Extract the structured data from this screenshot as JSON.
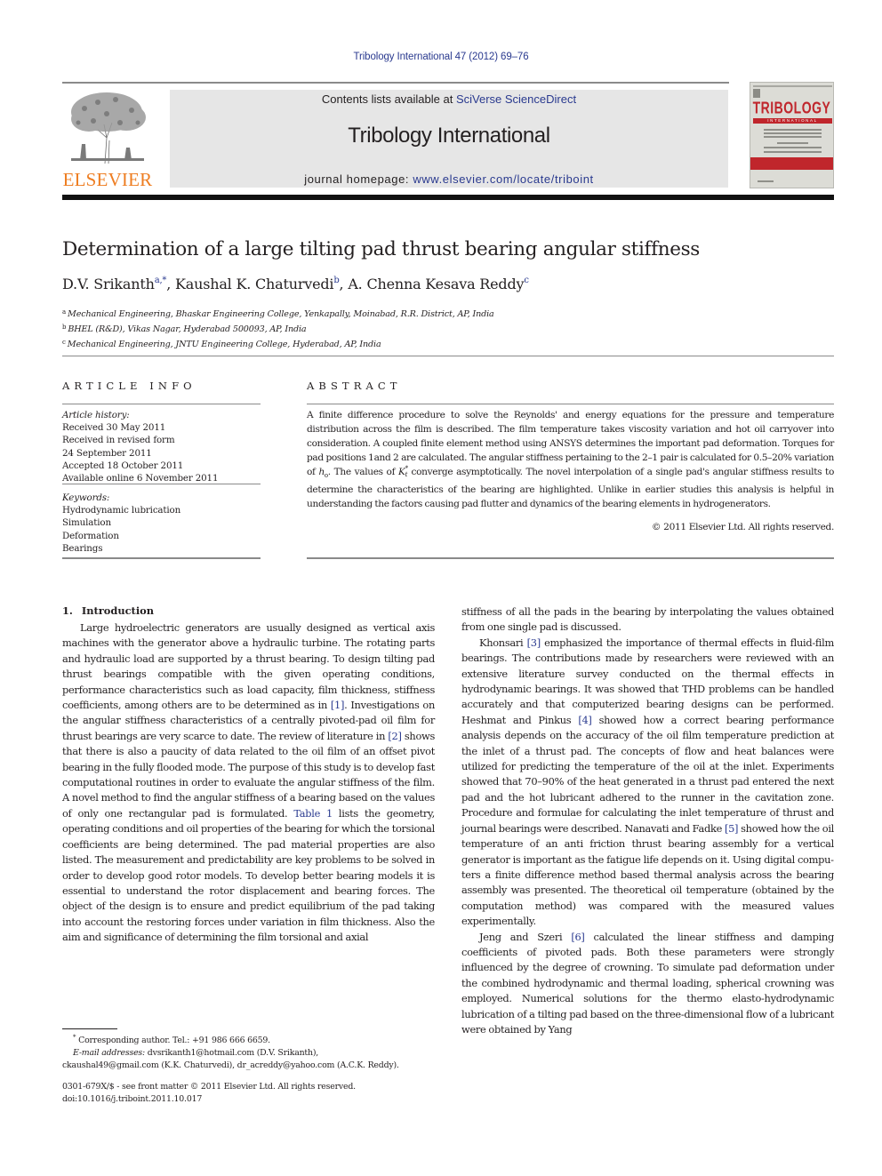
{
  "header": {
    "citation": "Tribology International 47 (2012) 69–76",
    "contents_prefix": "Contents lists available at ",
    "contents_link": "SciVerse ScienceDirect",
    "journal_title": "Tribology International",
    "homepage_prefix": "journal homepage: ",
    "homepage_link": "www.elsevier.com/locate/triboint",
    "publisher_logo_text": "ELSEVIER",
    "cover": {
      "title": "TRIBOLOGY",
      "subtitle": "INTERNATIONAL"
    },
    "colors": {
      "link": "#2a3a8f",
      "elsevier_orange": "#ee7d21",
      "cover_red": "#c0262c",
      "masthead_bg": "#e6e6e6"
    }
  },
  "article": {
    "title": "Determination of a large tilting pad thrust bearing angular stiffness",
    "authors": [
      {
        "name": "D.V. Srikanth",
        "sup": "a,*",
        "sep": ", "
      },
      {
        "name": "Kaushal K. Chaturvedi",
        "sup": "b",
        "sep": ", "
      },
      {
        "name": "A. Chenna Kesava Reddy",
        "sup": "c",
        "sep": ""
      }
    ],
    "affiliations": [
      {
        "key": "a",
        "text": "Mechanical Engineering, Bhaskar Engineering College, Yenkapally, Moinabad, R.R. District, AP, India"
      },
      {
        "key": "b",
        "text": "BHEL (R&D), Vikas Nagar, Hyderabad 500093, AP, India"
      },
      {
        "key": "c",
        "text": "Mechanical Engineering, JNTU Engineering College, Hyderabad, AP, India"
      }
    ]
  },
  "article_info": {
    "heading": "ARTICLE INFO",
    "history_label": "Article history:",
    "history": [
      "Received 30 May 2011",
      "Received in revised form",
      "24 September 2011",
      "Accepted 18 October 2011",
      "Available online 6 November 2011"
    ],
    "keywords_label": "Keywords:",
    "keywords": [
      "Hydrodynamic lubrication",
      "Simulation",
      "Deformation",
      "Bearings"
    ]
  },
  "abstract": {
    "heading": "ABSTRACT",
    "text_1": "A finite difference procedure to solve the Reynolds' and energy equations for the pressure and temperature distribution across the film is described. The film temperature takes viscosity variation and hot oil carryover into consideration. A coupled finite element method using ANSYS determines the important pad deformation. Torques for pad positions 1and 2 are calculated. The angular stiffness pertaining to the 2–1 pair is calculated for 0.5–20% variation of ",
    "sym_h": "h",
    "sym_h_sub": "o",
    "text_2": ". The values of ",
    "sym_k": "K",
    "sym_k_sup": "*",
    "sym_k_sub": "t",
    "text_3": " converge asymptotically. The novel interpolation of a single pad's angular stiffness results to determine the characteristics of the bearing are highlighted. Unlike in earlier studies this analysis is helpful in understanding the factors causing pad flutter and dynamics of the bearing elements in hydrogenerators.",
    "copyright": "© 2011 Elsevier Ltd. All rights reserved."
  },
  "body": {
    "section_number": "1.",
    "section_title": "Introduction",
    "left_p1_a": "Large hydroelectric generators are usually designed as vertical axis machines with the generator above a hydraulic turbine. The rotating parts and hydraulic load are supported by a thrust bearing. To design tilting pad thrust bearings compatible with the given operating conditions, performance characteristics such as load capa­city, film thickness, stiffness coefficients, among others are to be determined as in ",
    "ref1": "[1]",
    "left_p1_b": ". Investigations on the angular stiffness char­acteristics of a centrally pivoted-pad oil film for thrust bearings are very scarce to date. The review of literature in ",
    "ref2": "[2]",
    "left_p1_c": " shows that there is also a paucity of data related to the oil film of an offset pivot bearing in the fully flooded mode. The purpose of this study is to develop fast computational routines in order to evaluate the angular stiffness of the film. A novel method to find the angular stiffness of a bearing based on the values of only one rectangular pad is formulated. ",
    "table1": "Table 1",
    "left_p1_d": " lists the geometry, operating conditions and oil properties of the bearing for which the torsional coefficients are being determined. The pad material properties are also listed. The measurement and predictability are key problems to be solved in order to develop good rotor models. To develop better bearing models it is essential to understand the rotor displacement and bearing forces. The object of the design is to ensure and predict equilibrium of the pad taking into account the restoring forces under variation in film thickness. Also the aim and significance of determining the film torsional and axial",
    "right_p0": "stiffness of all the pads in the bearing by interpolating the values obtained from one single pad is discussed.",
    "right_p1_a": "Khonsari ",
    "ref3": "[3]",
    "right_p1_b": " emphasized the importance of thermal effects in fluid-film bearings. The contributions made by researchers were reviewed with an extensive literature survey conducted on the thermal effects in hydrodynamic bearings. It was showed that THD problems can be handled accurately and that computerized bearing designs can be performed. Heshmat and Pinkus ",
    "ref4": "[4]",
    "right_p1_c": " showed how a correct bearing performance analysis depends on the accuracy of the oil film temperature prediction at the inlet of a thrust pad. The concepts of flow and heat balances were utilized for predicting the temperature of the oil at the inlet. Experiments showed that 70–90% of the heat generated in a thrust pad entered the next pad and the hot lubricant adhered to the runner in the cavitation zone. Procedure and formulae for calculating the inlet temperature of thrust and journal bearings were described. Nanavati and Fadke ",
    "ref5": "[5]",
    "right_p1_d": " showed how the oil temperature of an anti friction thrust bearing assembly for a vertical generator is important as the fatigue life depends on it. Using digital compu­ters a finite difference method based thermal analysis across the bearing assembly was presented. The theoretical oil temperature (obtained by the computation method) was compared with the measured values experimentally.",
    "right_p2_a": "Jeng and Szeri ",
    "ref6": "[6]",
    "right_p2_b": " calculated the linear stiffness and damping coefficients of pivoted pads. Both these parameters were strongly influenced by the degree of crowning. To simulate pad deforma­tion under the combined hydrodynamic and thermal loading, spherical crowning was employed. Numerical solutions for the thermo elasto-hydrodynamic lubrication of a tilting pad based on the three-dimensional flow of a lubricant were obtained by Yang"
  },
  "footnotes": {
    "corresponding_mark": "*",
    "corresponding": " Corresponding author. Tel.: +91 986 666 6659.",
    "email_label": "E-mail addresses:",
    "email_1": " dvsrikanth1@hotmail.com (D.V. Srikanth),",
    "email_2": "ckaushal49@gmail.com (K.K. Chaturvedi), dr_acreddy@yahoo.com (A.C.K. Reddy).",
    "front_matter": "0301-679X/$ - see front matter © 2011 Elsevier Ltd. All rights reserved.",
    "doi": "doi:10.1016/j.triboint.2011.10.017"
  }
}
